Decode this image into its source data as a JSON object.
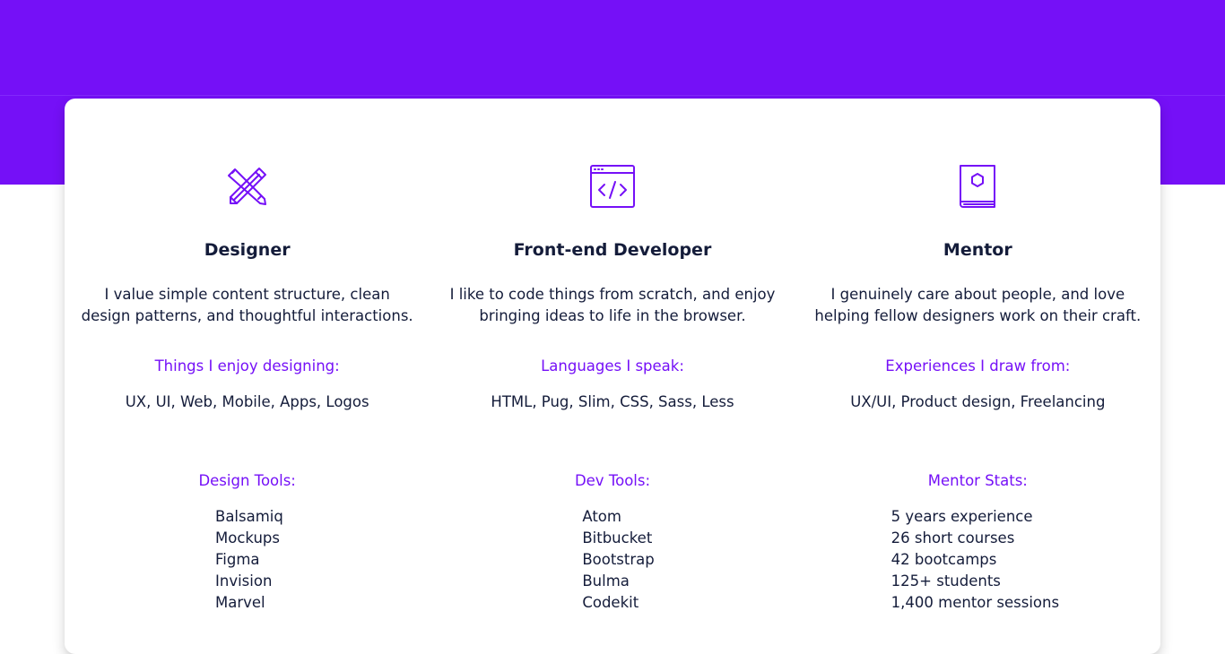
{
  "colors": {
    "brand": "#7510f7",
    "text": "#141c3a",
    "background": "#ffffff"
  },
  "columns": [
    {
      "icon": "pencil-ruler-icon",
      "title": "Designer",
      "description": "I value simple content structure, clean design patterns, and thoughtful interactions.",
      "subheading": "Things I enjoy designing:",
      "items_text": "UX, UI, Web, Mobile, Apps, Logos",
      "tools_heading": "Design Tools:",
      "tools": [
        "Balsamiq",
        "Mockups",
        "Figma",
        "Invision",
        "Marvel"
      ]
    },
    {
      "icon": "code-window-icon",
      "title": "Front-end Developer",
      "description": "I like to code things from scratch, and enjoy bringing ideas to life in the browser.",
      "subheading": "Languages I speak:",
      "items_text": "HTML, Pug, Slim, CSS, Sass, Less",
      "tools_heading": "Dev Tools:",
      "tools": [
        "Atom",
        "Bitbucket",
        "Bootstrap",
        "Bulma",
        "Codekit"
      ]
    },
    {
      "icon": "book-icon",
      "title": "Mentor",
      "description": "I genuinely care about people, and love helping fellow designers work on their craft.",
      "subheading": "Experiences I draw from:",
      "items_text": "UX/UI, Product design, Freelancing",
      "tools_heading": "Mentor Stats:",
      "tools": [
        "5 years experience",
        "26 short courses",
        "42 bootcamps",
        "125+ students",
        "1,400 mentor sessions"
      ]
    }
  ]
}
